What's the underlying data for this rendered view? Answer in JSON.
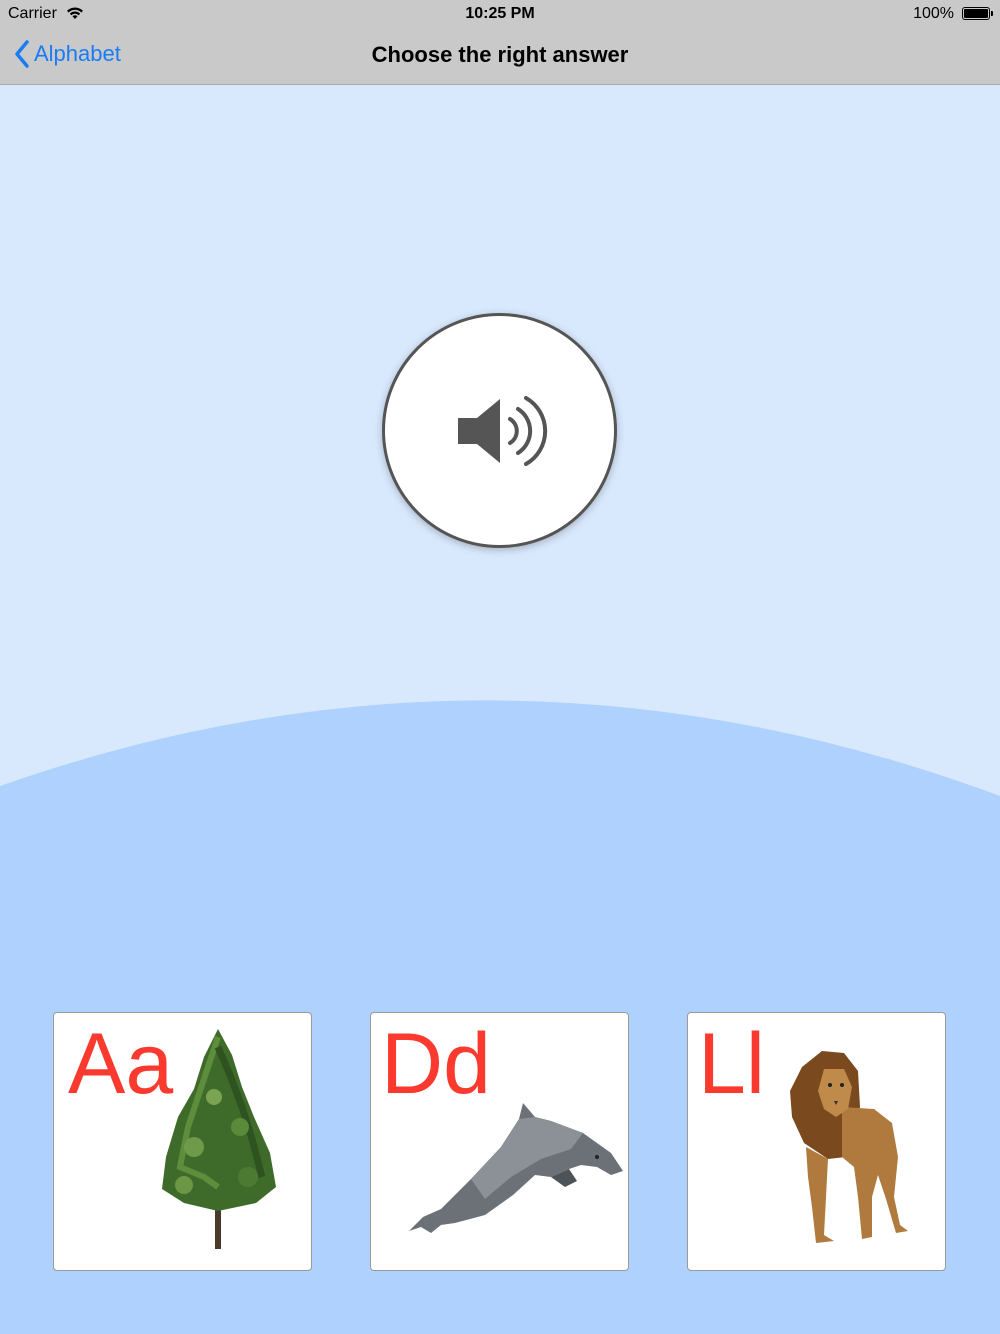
{
  "status_bar": {
    "carrier": "Carrier",
    "time": "10:25 PM",
    "battery": "100%"
  },
  "nav": {
    "back_label": "Alphabet",
    "title": "Choose the right answer"
  },
  "colors": {
    "top_bg": "#d9e9fd",
    "bottom_bg": "#aed1fd",
    "nav_bg": "#c9c9c9",
    "back_link": "#1a7cf5",
    "letter": "#fb3a2f"
  },
  "cards": [
    {
      "letters": "Aa",
      "picture": "tree"
    },
    {
      "letters": "Dd",
      "picture": "dolphin"
    },
    {
      "letters": "Ll",
      "picture": "lion"
    }
  ]
}
